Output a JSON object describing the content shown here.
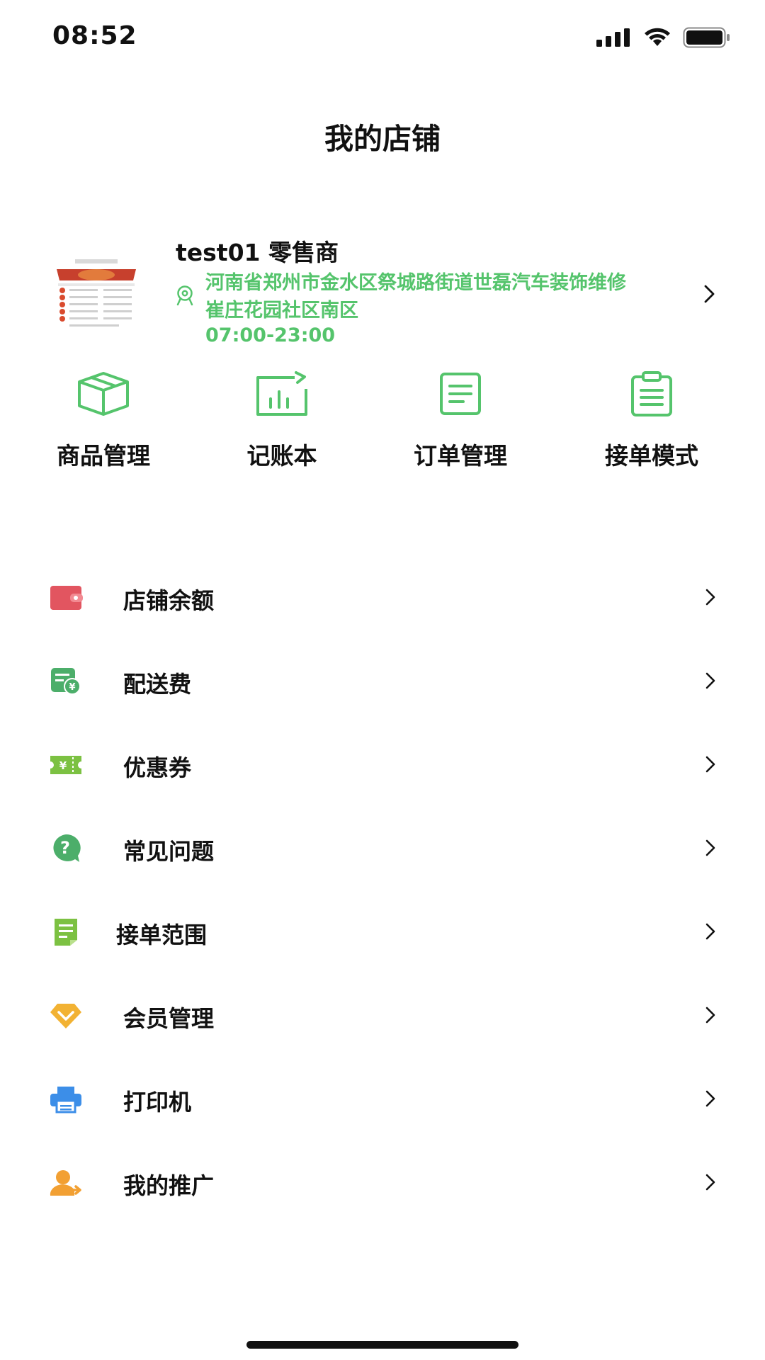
{
  "status_bar": {
    "time": "08:52"
  },
  "header": {
    "title": "我的店铺"
  },
  "store": {
    "name": "test01 零售商",
    "address": "河南省郑州市金水区祭城路街道世磊汽车装饰维修崔庄花园社区南区",
    "hours": "07:00-23:00"
  },
  "actions": [
    {
      "label": "商品管理",
      "icon": "box-icon"
    },
    {
      "label": "记账本",
      "icon": "chart-icon"
    },
    {
      "label": "订单管理",
      "icon": "document-icon"
    },
    {
      "label": "接单模式",
      "icon": "clipboard-icon"
    }
  ],
  "menu": [
    {
      "label": "店铺余额",
      "icon": "wallet-icon",
      "color": "#e25560"
    },
    {
      "label": "配送费",
      "icon": "delivery-fee-icon",
      "color": "#4cae6a"
    },
    {
      "label": "优惠券",
      "icon": "coupon-icon",
      "color": "#7cc142"
    },
    {
      "label": "常见问题",
      "icon": "question-icon",
      "color": "#4cae6a"
    },
    {
      "label": "接单范围",
      "icon": "document-green-icon",
      "color": "#7cc142"
    },
    {
      "label": "会员管理",
      "icon": "diamond-icon",
      "color": "#f2b233"
    },
    {
      "label": "打印机",
      "icon": "printer-icon",
      "color": "#3c8ee8"
    },
    {
      "label": "我的推广",
      "icon": "user-share-icon",
      "color": "#f2a033"
    }
  ],
  "colors": {
    "accent_green": "#55c46c",
    "text": "#111111"
  }
}
